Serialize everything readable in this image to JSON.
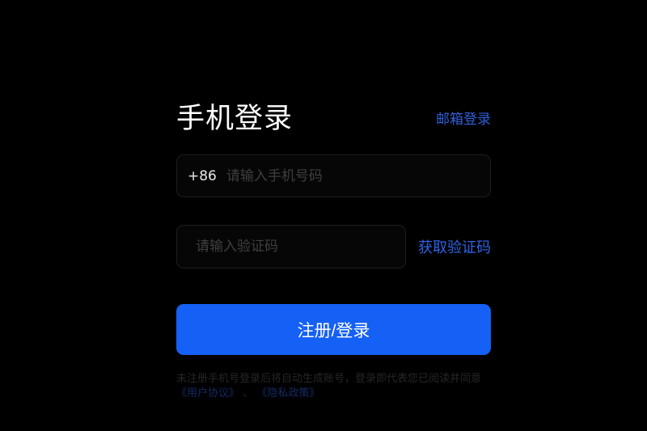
{
  "login": {
    "title": "手机登录",
    "email_login_link": "邮箱登录",
    "phone": {
      "country_code": "+86",
      "placeholder": "请输入手机号码",
      "value": ""
    },
    "code": {
      "placeholder": "请输入验证码",
      "value": "",
      "get_code_label": "获取验证码"
    },
    "submit_label": "注册/登录",
    "agreement": {
      "text_before": "未注册手机号登录后将自动生成账号，登录即代表您已阅读并同意",
      "user_agreement": "《用户协议》",
      "separator": "、",
      "privacy_policy": "《隐私政策》"
    }
  },
  "colors": {
    "background": "#000000",
    "accent": "#1560f5",
    "link": "#2f5fd9"
  }
}
